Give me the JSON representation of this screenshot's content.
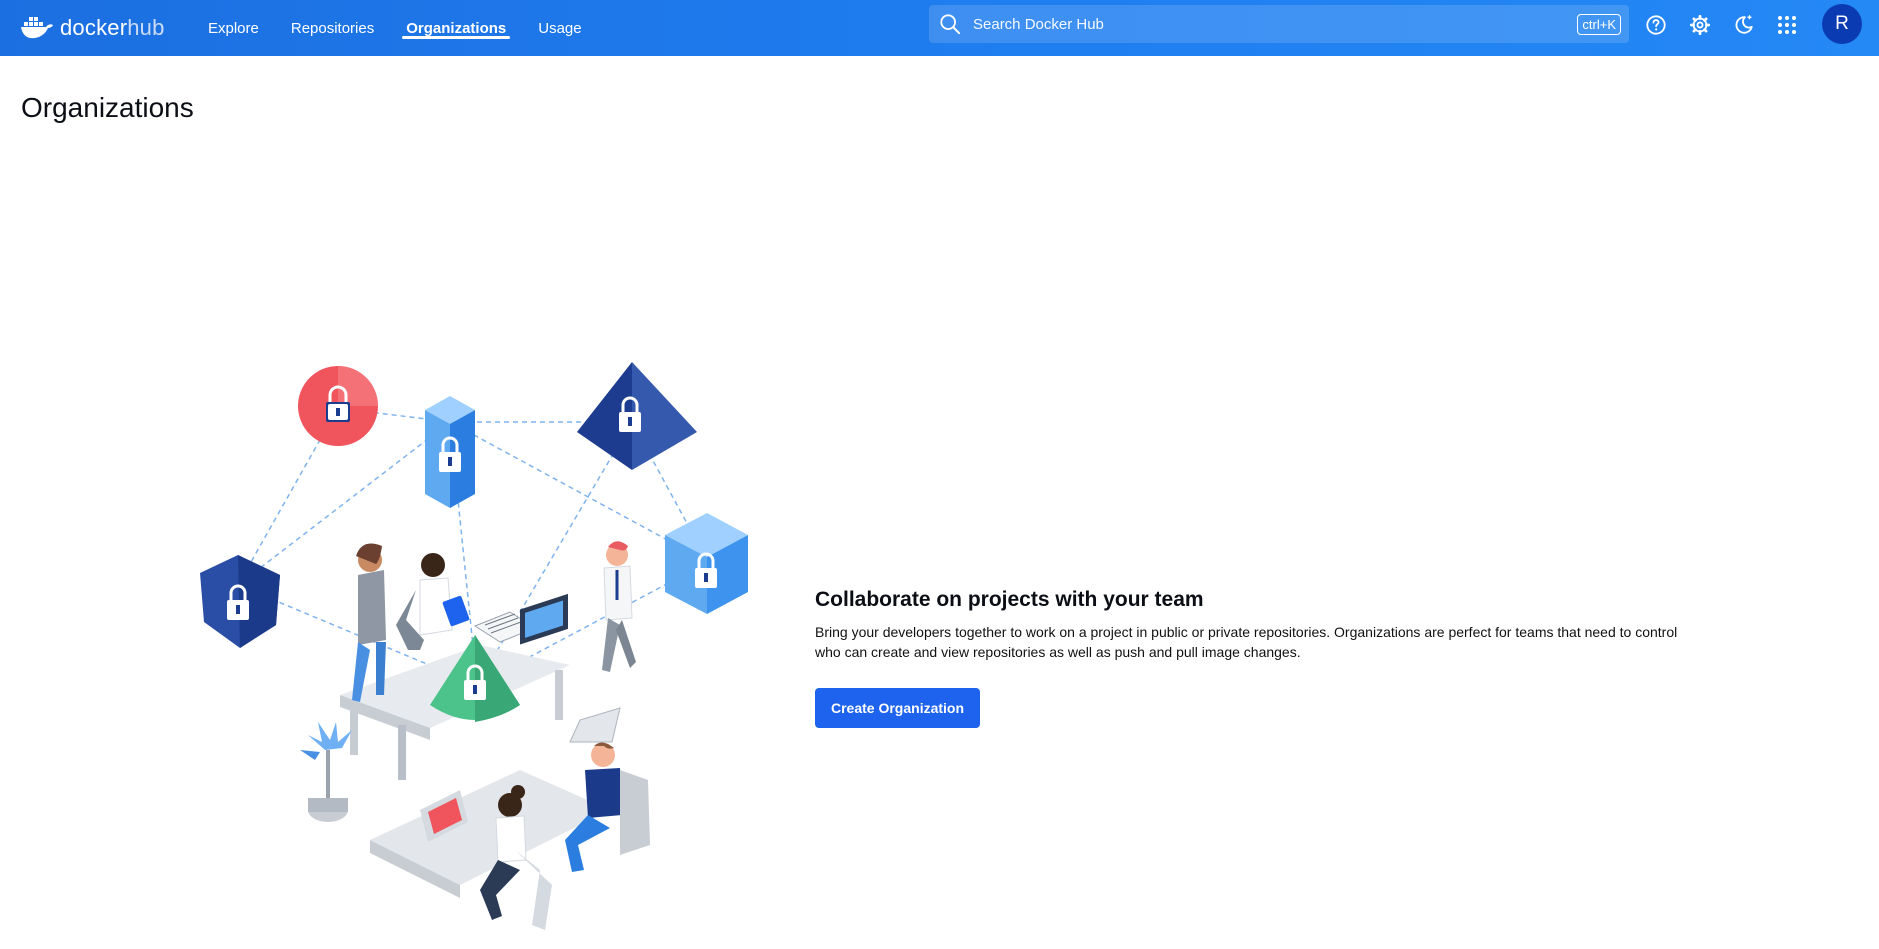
{
  "header": {
    "logo": {
      "text_primary": "docker",
      "text_secondary": "hub",
      "icon": "docker-whale-icon"
    },
    "nav": [
      {
        "label": "Explore",
        "active": false
      },
      {
        "label": "Repositories",
        "active": false
      },
      {
        "label": "Organizations",
        "active": true
      },
      {
        "label": "Usage",
        "active": false
      }
    ],
    "search": {
      "placeholder": "Search Docker Hub",
      "shortcut": "ctrl+K",
      "icon": "search-icon"
    },
    "icons": [
      "help-icon",
      "gear-icon",
      "theme-toggle-icon",
      "apps-grid-icon"
    ],
    "avatar_initial": "R"
  },
  "page": {
    "title": "Organizations",
    "empty_state": {
      "heading": "Collaborate on projects with your team",
      "body": "Bring your developers together to work on a project in public or private repositories. Organizations are perfect for teams that need to control who can create and view repositories as well as push and pull image changes.",
      "button_label": "Create Organization"
    }
  },
  "colors": {
    "header": "#1f7ef0",
    "primary_button": "#1d63ed",
    "avatar": "#0b3bb3"
  }
}
